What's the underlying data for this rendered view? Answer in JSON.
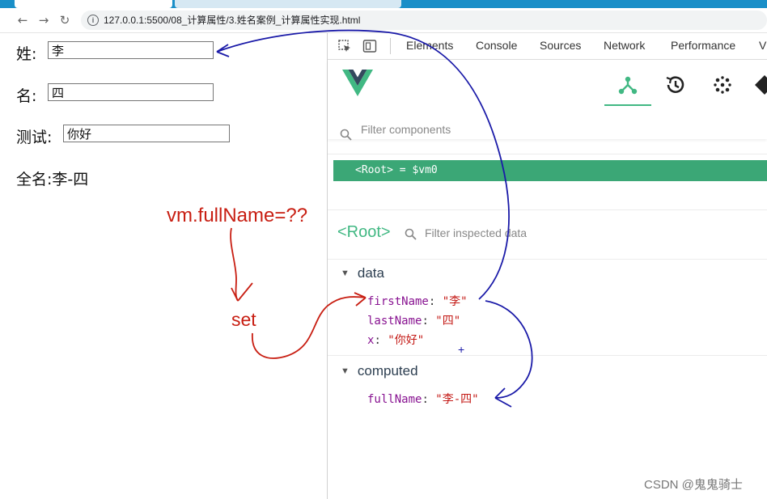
{
  "browser": {
    "url": "127.0.0.1:5500/08_计算属性/3.姓名案例_计算属性实现.html"
  },
  "page": {
    "surname_label": "姓:",
    "surname_value": "李",
    "given_label": "名:",
    "given_value": "四",
    "test_label": "测试:",
    "test_value": "你好",
    "fullname_label": "全名:",
    "fullname_value": "李-四"
  },
  "devtools": {
    "tabs": [
      "Elements",
      "Console",
      "Sources",
      "Network",
      "Performance",
      "V"
    ],
    "filter_components_placeholder": "Filter components",
    "root_row": "<Root> = $vm0",
    "inspected_name": "<Root>",
    "filter_inspected_placeholder": "Filter inspected data",
    "data_section": "data",
    "data": [
      {
        "key": "firstName",
        "value": "\"李\""
      },
      {
        "key": "lastName",
        "value": "\"四\""
      },
      {
        "key": "x",
        "value": "\"你好\""
      }
    ],
    "computed_section": "computed",
    "computed": [
      {
        "key": "fullName",
        "value": "\"李-四\""
      }
    ],
    "colors": {
      "vue_green": "#41b883",
      "vue_dark": "#34495e",
      "root_row_bg": "#3ba776"
    }
  },
  "annotations": {
    "question": "vm.fullName=??",
    "set": "set",
    "plus": "+"
  },
  "watermark": "CSDN @鬼鬼骑士"
}
